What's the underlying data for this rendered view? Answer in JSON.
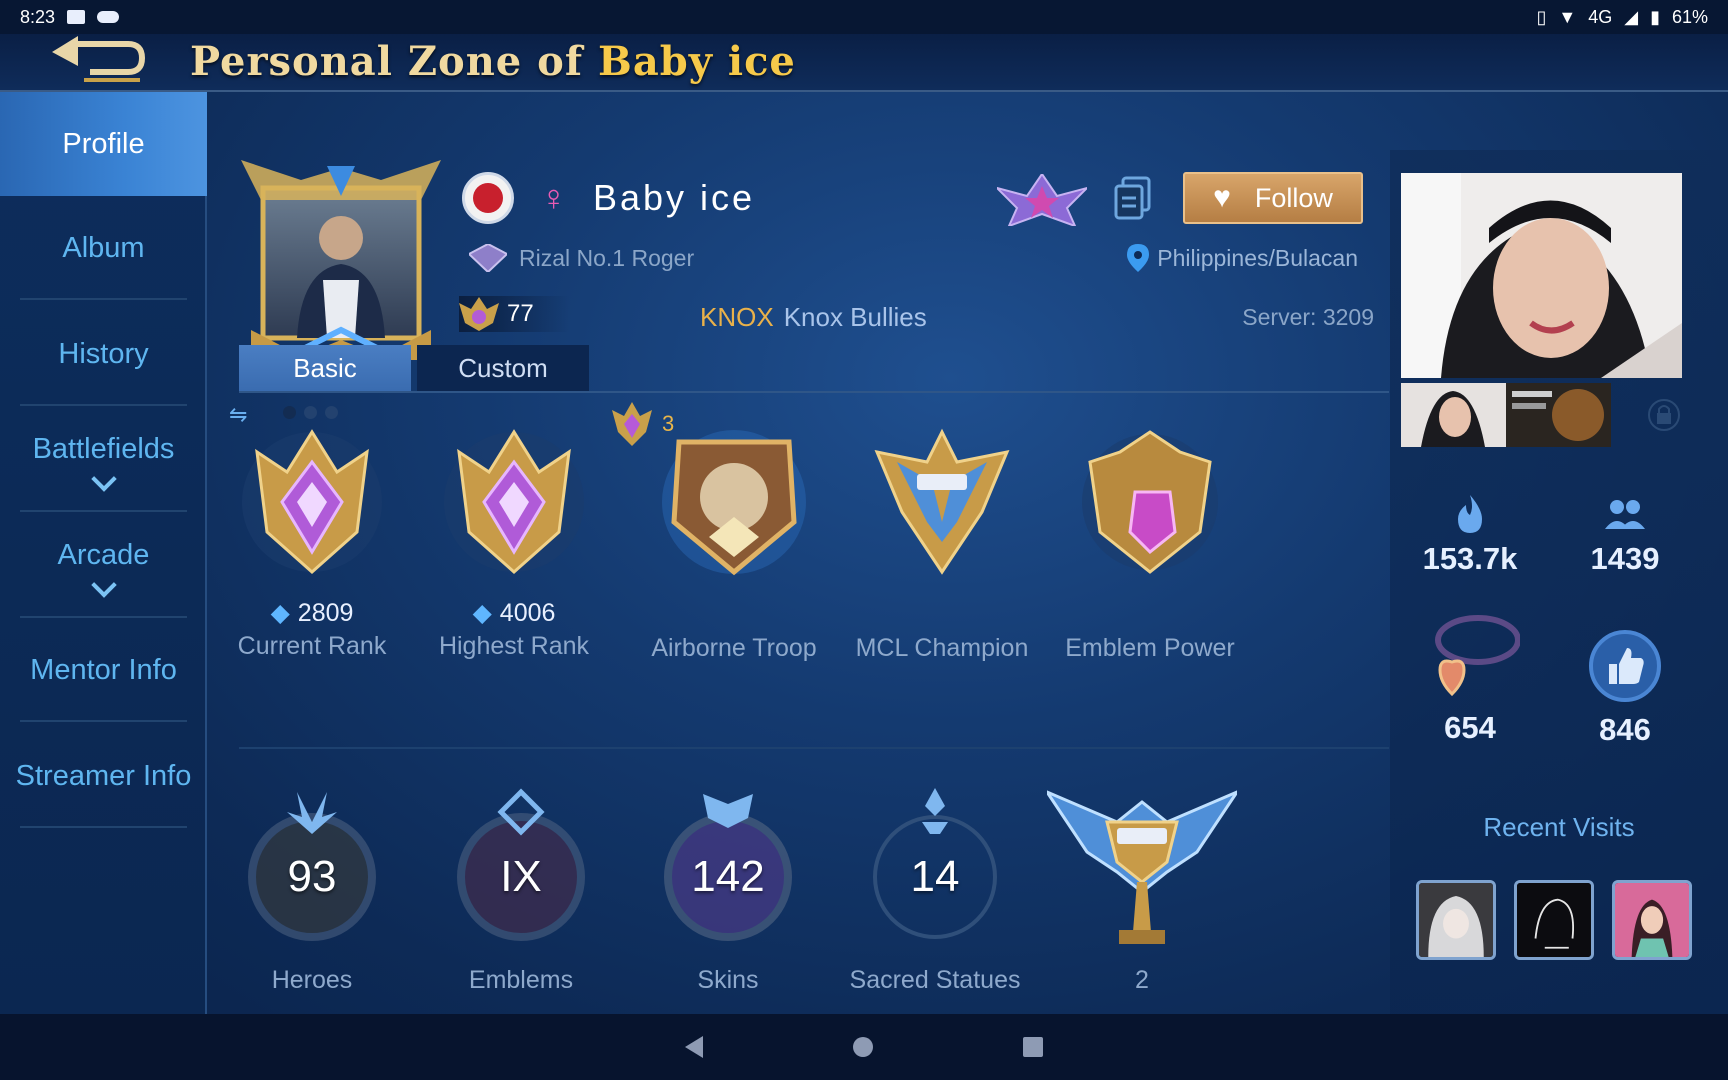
{
  "statusbar": {
    "time": "8:23",
    "network": "4G",
    "battery": "61%"
  },
  "header": {
    "title_prefix": "Personal Zone of",
    "title_name": "Baby ice"
  },
  "sidebar": {
    "items": [
      {
        "label": "Profile",
        "active": true
      },
      {
        "label": "Album"
      },
      {
        "label": "History"
      },
      {
        "label": "Battlefields",
        "expand": true
      },
      {
        "label": "Arcade",
        "expand": true
      },
      {
        "label": "Mentor Info"
      },
      {
        "label": "Streamer Info"
      }
    ]
  },
  "profile": {
    "gender_symbol": "♀",
    "name": "Baby ice",
    "follow_label": "Follow",
    "title": "Rizal No.1 Roger",
    "location": "Philippines/Bulacan",
    "level": "77",
    "squad_tag": "KNOX",
    "squad_name": "Knox Bullies",
    "server_label": "Server:",
    "server_value": "3209"
  },
  "tabs": [
    {
      "label": "Basic",
      "active": true
    },
    {
      "label": "Custom"
    }
  ],
  "star_count": "3",
  "badges": [
    {
      "value": "2809",
      "label": "Current Rank"
    },
    {
      "value": "4006",
      "label": "Highest Rank"
    },
    {
      "label": "Airborne Troop"
    },
    {
      "label": "MCL Champion"
    },
    {
      "label": "Emblem Power"
    }
  ],
  "stats": [
    {
      "value": "93",
      "label": "Heroes"
    },
    {
      "value": "IX",
      "label": "Emblems"
    },
    {
      "value": "142",
      "label": "Skins"
    },
    {
      "value": "14",
      "label": "Sacred Statues"
    },
    {
      "value": "2",
      "label": ""
    }
  ],
  "right_panel": {
    "popularity": "153.7k",
    "followers": "1439",
    "charms": "654",
    "likes": "846",
    "recent_visits_label": "Recent Visits"
  },
  "colors": {
    "accent_gold": "#f6c94a",
    "sidebar_active": "#3a83d4",
    "follow": "#c48f55"
  }
}
